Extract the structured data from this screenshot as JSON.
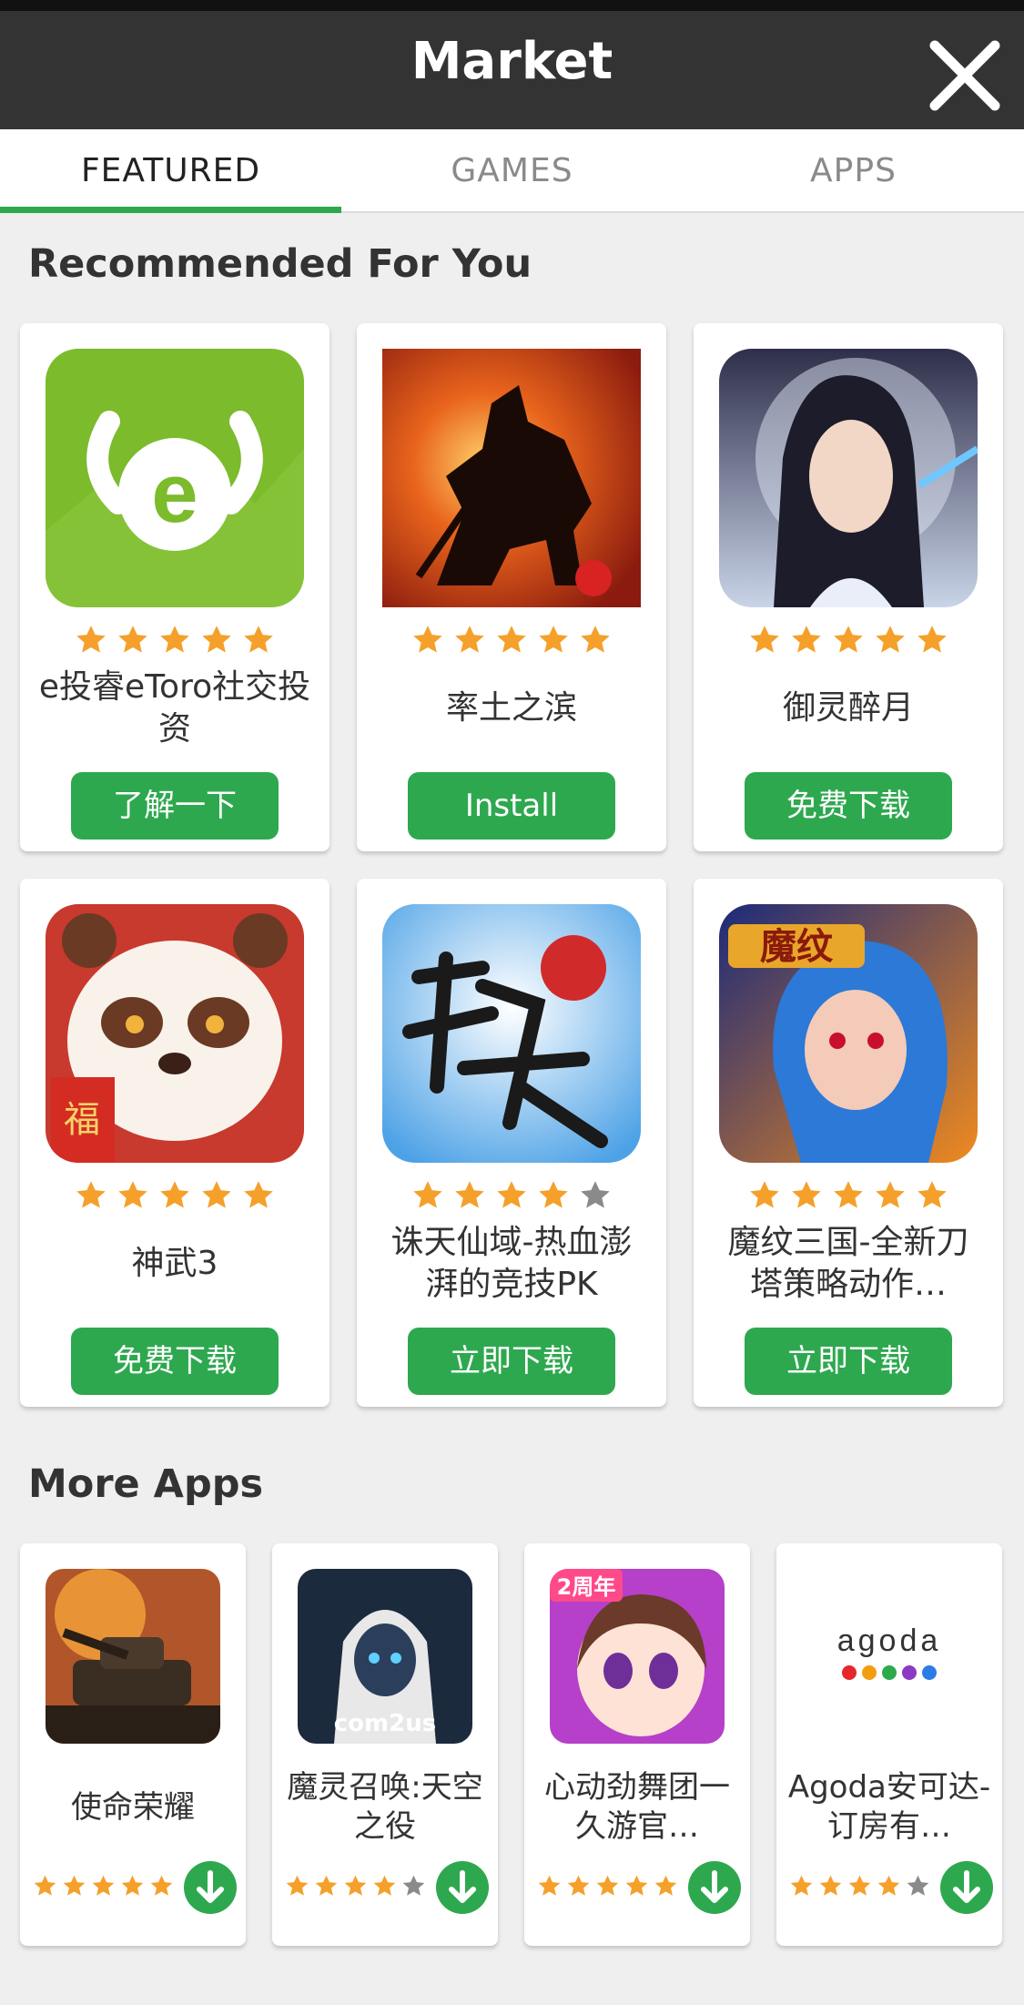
{
  "header": {
    "title": "Market"
  },
  "tabs": [
    {
      "label": "FEATURED",
      "active": true
    },
    {
      "label": "GAMES",
      "active": false
    },
    {
      "label": "APPS",
      "active": false
    }
  ],
  "recommended": {
    "title": "Recommended For You",
    "apps": [
      {
        "name": "e投睿eToro社交投资",
        "rating": 5,
        "button": "了解一下",
        "icon": "etoro-bull-icon"
      },
      {
        "name": "率土之滨",
        "rating": 5,
        "button": "Install",
        "icon": "horseman-sunset-icon"
      },
      {
        "name": "御灵醉月",
        "rating": 5,
        "button": "免费下载",
        "icon": "swordsman-portrait-icon"
      },
      {
        "name": "神武3",
        "rating": 5,
        "button": "免费下载",
        "icon": "panda-icon"
      },
      {
        "name": "诛天仙域-热血澎湃的竞技PK",
        "rating": 4,
        "button": "立即下载",
        "icon": "calligraphy-zhutian-icon"
      },
      {
        "name": "魔纹三国-全新刀塔策略动作…",
        "rating": 5,
        "button": "立即下载",
        "icon": "mowen-warrior-icon"
      }
    ]
  },
  "more_apps": {
    "title": "More Apps",
    "apps": [
      {
        "name": "使命荣耀",
        "rating": 5,
        "icon": "tank-icon"
      },
      {
        "name": "魔灵召唤:天空之役",
        "rating": 4,
        "icon": "com2us-hero-icon"
      },
      {
        "name": "心动劲舞团一久游官…",
        "rating": 5,
        "icon": "anime-girl-icon",
        "badge": "2周年"
      },
      {
        "name": "Agoda安可达-订房有…",
        "rating": 4,
        "icon": "agoda-logo-icon",
        "logo_text": "agoda"
      }
    ]
  },
  "colors": {
    "accent_green": "#2ea84f",
    "star_orange": "#f5a02a",
    "star_gray": "#8a8a8a",
    "header_bg": "#333333"
  }
}
